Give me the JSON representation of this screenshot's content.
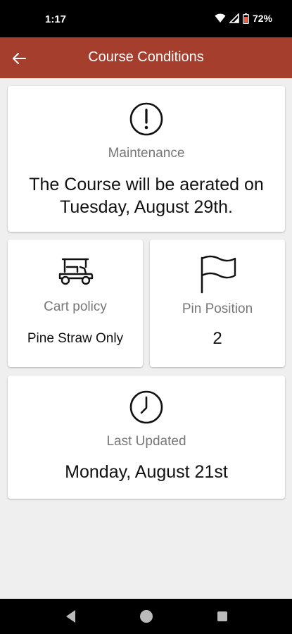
{
  "status_bar": {
    "time": "1:17",
    "battery": "72%"
  },
  "app_bar": {
    "title": "Course Conditions"
  },
  "maintenance": {
    "label": "Maintenance",
    "message": "The Course will be aerated on Tuesday, August 29th."
  },
  "cart_policy": {
    "label": "Cart policy",
    "value": "Pine Straw Only"
  },
  "pin_position": {
    "label": "Pin Position",
    "value": "2"
  },
  "last_updated": {
    "label": "Last Updated",
    "value": "Monday, August 21st"
  },
  "colors": {
    "app_bar": "#a53e2c",
    "background": "#efefef",
    "card": "#ffffff",
    "label": "#777777"
  }
}
